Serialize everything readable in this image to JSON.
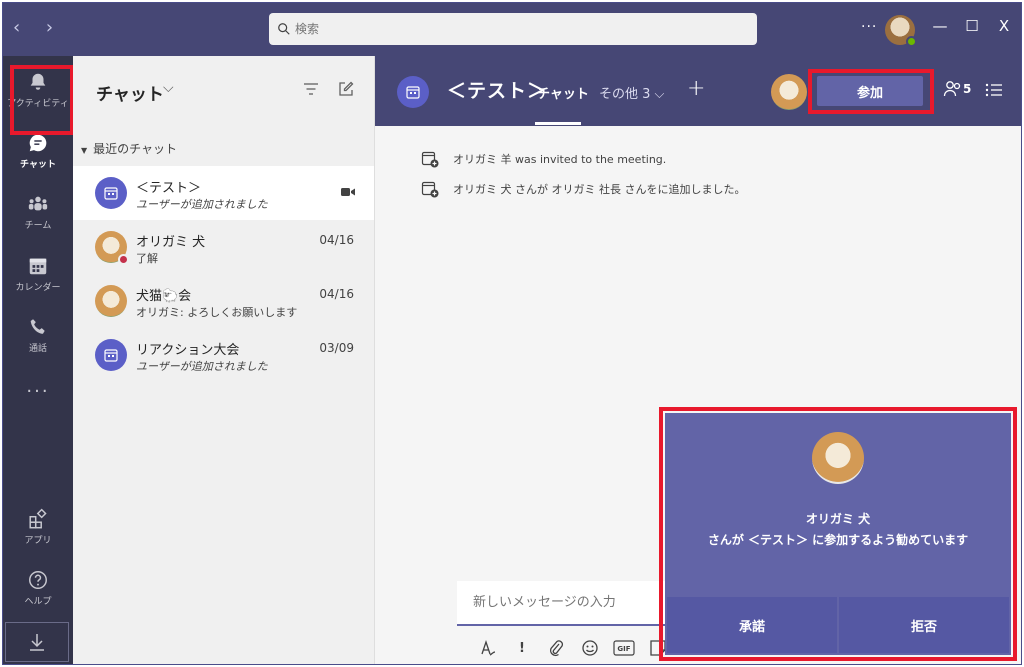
{
  "titlebar": {
    "search_placeholder": "検索",
    "nav_arrows": "‹ ›",
    "ellipsis": "···",
    "minimize": "—",
    "maximize": "☐",
    "close": "X"
  },
  "rail": {
    "items": [
      {
        "label": "アクティビティ",
        "icon": "bell-icon"
      },
      {
        "label": "チャット",
        "icon": "chat-icon"
      },
      {
        "label": "チーム",
        "icon": "teams-icon"
      },
      {
        "label": "カレンダー",
        "icon": "calendar-icon"
      },
      {
        "label": "通話",
        "icon": "phone-icon"
      },
      {
        "label": "アプリ",
        "icon": "apps-icon"
      },
      {
        "label": "ヘルプ",
        "icon": "help-icon"
      }
    ],
    "more": "···",
    "active": "チャット"
  },
  "chatlist": {
    "title": "チャット",
    "chevron": "⌵",
    "section": "最近のチャット",
    "items": [
      {
        "name": "＜テスト＞",
        "preview": "ユーザーが追加されました",
        "date": "",
        "avatar": "meeting-icon"
      },
      {
        "name": "オリガミ 犬",
        "preview": "了解",
        "date": "04/16",
        "avatar": "dog-avatar"
      },
      {
        "name": "犬猫🐑会",
        "preview": "オリガミ: よろしくお願いします",
        "date": "04/16",
        "avatar": "dog-avatar"
      },
      {
        "name": "リアクション大会",
        "preview": "ユーザーが追加されました",
        "date": "03/09",
        "avatar": "meeting-icon"
      }
    ]
  },
  "main": {
    "title": "＜テスト＞",
    "tabs": [
      {
        "label": "チャット"
      },
      {
        "label": "その他 3 ⌵"
      }
    ],
    "plus": "+",
    "join_label": "参加",
    "participants_count": "5",
    "system_messages": [
      "オリガミ 羊 was invited to the meeting.",
      "オリガミ 犬 さんが オリガミ 社長 さんをに追加しました。"
    ],
    "compose_placeholder": "新しいメッセージの入力",
    "toolbar": {
      "important": "!",
      "gif": "GIF"
    }
  },
  "invite": {
    "name": "オリガミ 犬",
    "message": "さんが ＜テスト＞ に参加するよう勧めています",
    "accept": "承諾",
    "decline": "拒否"
  },
  "colors": {
    "titlebar": "#464775",
    "rail": "#33344a",
    "accent": "#6264a7",
    "highlight": "#e8192c"
  }
}
